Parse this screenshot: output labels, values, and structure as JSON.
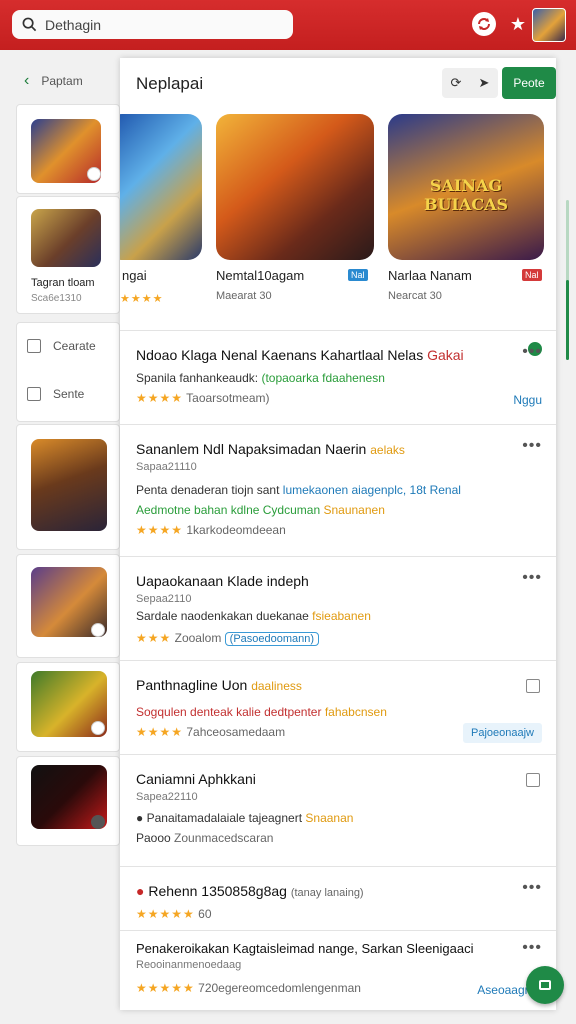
{
  "topbar": {
    "search_text": "Dethagin",
    "accent": "#c62828"
  },
  "sidebar": {
    "back_label": "Paptam",
    "card2_label": "Tagran tloam",
    "card2_sub": "Sca6e1310",
    "menu": [
      {
        "label": "Cearate",
        "icon": "calendar-icon"
      },
      {
        "label": "Sente",
        "icon": "folder-icon"
      }
    ]
  },
  "panel": {
    "title": "Neplapai",
    "green_button": "Peote",
    "games": [
      {
        "title": "ngai",
        "sub": "",
        "stars": "★★★★"
      },
      {
        "title": "Nemtal10agam",
        "sub": "Maearat 30",
        "tag": "Nal"
      },
      {
        "title": "Narlaa Nanam",
        "sub": "Nearcat 30",
        "tag": "Nal",
        "art_text": "SAINAG BUIACAS"
      }
    ],
    "items": [
      {
        "title": "Ndoao Klaga Nenal Kaenans Kahartlaal Nelas",
        "title_hl": "Gakai",
        "line1": "Spanila fanhankeaudk:",
        "line1_hl": "(topaoarka fdaahenesn",
        "rating": "★★★★",
        "rating_text": "Taoarsotmeam)",
        "link": "Nggu"
      },
      {
        "title": "Sananlem Ndl Napaksimadan Naerin",
        "title_hl": "aelaks",
        "small": "Sapaa21110",
        "line1": "Penta denaderan tiojn sant",
        "line1_hl": "lumekaonen aiagenplc, 18t",
        "line1_tail": "Renal",
        "line2": "Aedmotne bahan kdlne Cydcuman",
        "line2_hl": "Snaunanen",
        "rating": "★★★★",
        "rating_text": "1karkodeomdeean"
      },
      {
        "title": "Uapaokanaan Klade indeph",
        "small": "Sepaa2110",
        "line1": "Sardale naodenkakan duekanae",
        "line1_hl": "fsieabanen",
        "rating": "★★★",
        "rating_text": "Zooalom",
        "tag": "(Pasoedoomann)"
      },
      {
        "title": "Panthnagline Uon",
        "title_hl": "daaliness",
        "line1": "Sogqulen denteak kalie dedtpenter",
        "line1_hl": "fahabcnsen",
        "rating": "★★★★",
        "rating_text": "7ahceosamedaam",
        "pill": "Pajoeonaajw"
      },
      {
        "title": "Caniamni Aphkkani",
        "small": "Sapea22110",
        "line1": "Panaitamadalaiale tajeagnert",
        "line1_hl": "Snaanan",
        "rating_text": "Paooo",
        "rating_text2": "Zounmacedscaran"
      },
      {
        "title": "Rehenn 1350858g8ag",
        "title_tail": "(tanay lanaing)",
        "rating": "★★★★★",
        "rating_text": "60"
      },
      {
        "title": "Penakeroikakan Kagtaisleimad nange, Sarkan Sleenigaaci",
        "small": "Reooinanmenoedaag",
        "rating": "★★★★★",
        "rating_text": "720egereomcedomlengenman",
        "link": "Aseoaagrna"
      }
    ]
  }
}
